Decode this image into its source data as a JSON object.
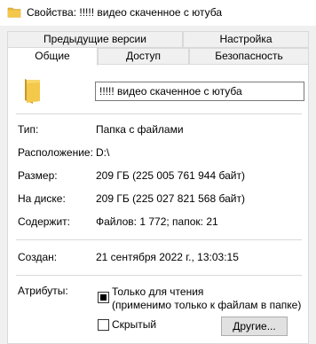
{
  "window": {
    "title": "Свойства: !!!!! видео скаченное с ютуба"
  },
  "tabs": {
    "row1": [
      "Предыдущие версии",
      "Настройка"
    ],
    "row2": [
      "Общие",
      "Доступ",
      "Безопасность"
    ],
    "active": "Общие"
  },
  "general": {
    "name_value": "!!!!! видео скаченное с ютуба",
    "icon": "folder-icon",
    "type_label": "Тип:",
    "type_value": "Папка с файлами",
    "location_label": "Расположение:",
    "location_value": "D:\\",
    "size_label": "Размер:",
    "size_value": "209 ГБ (225 005 761 944 байт)",
    "disk_label": "На диске:",
    "disk_value": "209 ГБ (225 027 821 568 байт)",
    "contains_label": "Содержит:",
    "contains_value": "Файлов: 1 772; папок: 21",
    "created_label": "Создан:",
    "created_value": "21 сентября 2022 г., 13:03:15",
    "attributes_label": "Атрибуты:",
    "readonly_label": "Только для чтения",
    "readonly_note": "(применимо только к файлам в папке)",
    "readonly_state": "indeterminate",
    "hidden_label": "Скрытый",
    "hidden_checked": false,
    "other_button": "Другие..."
  },
  "colors": {
    "folder": "#e8b93a",
    "background": "#f0f0f0",
    "panel": "#ffffff"
  }
}
